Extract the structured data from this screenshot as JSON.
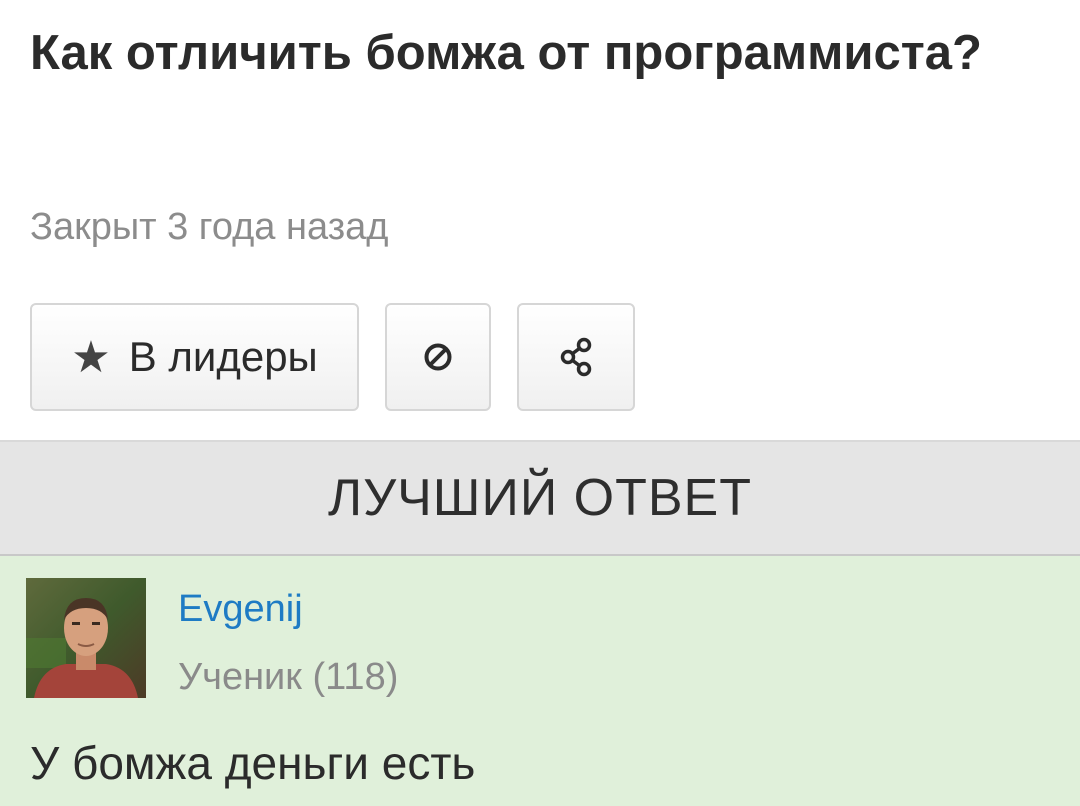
{
  "question": {
    "title": "Как отличить бомжа от программиста?",
    "status": "Закрыт 3 года назад"
  },
  "actions": {
    "leaders_label": "В лидеры",
    "leaders_icon": "star-icon",
    "block_icon": "block-icon",
    "share_icon": "share-icon"
  },
  "best_answer": {
    "header": "ЛУЧШИЙ ОТВЕТ",
    "author": {
      "name": "Evgenij",
      "rank": "Ученик (118)"
    },
    "text": "У бомжа деньги есть"
  },
  "colors": {
    "answer_background": "#e0f0da",
    "header_background": "#e5e5e5",
    "link": "#1e7bc4"
  }
}
